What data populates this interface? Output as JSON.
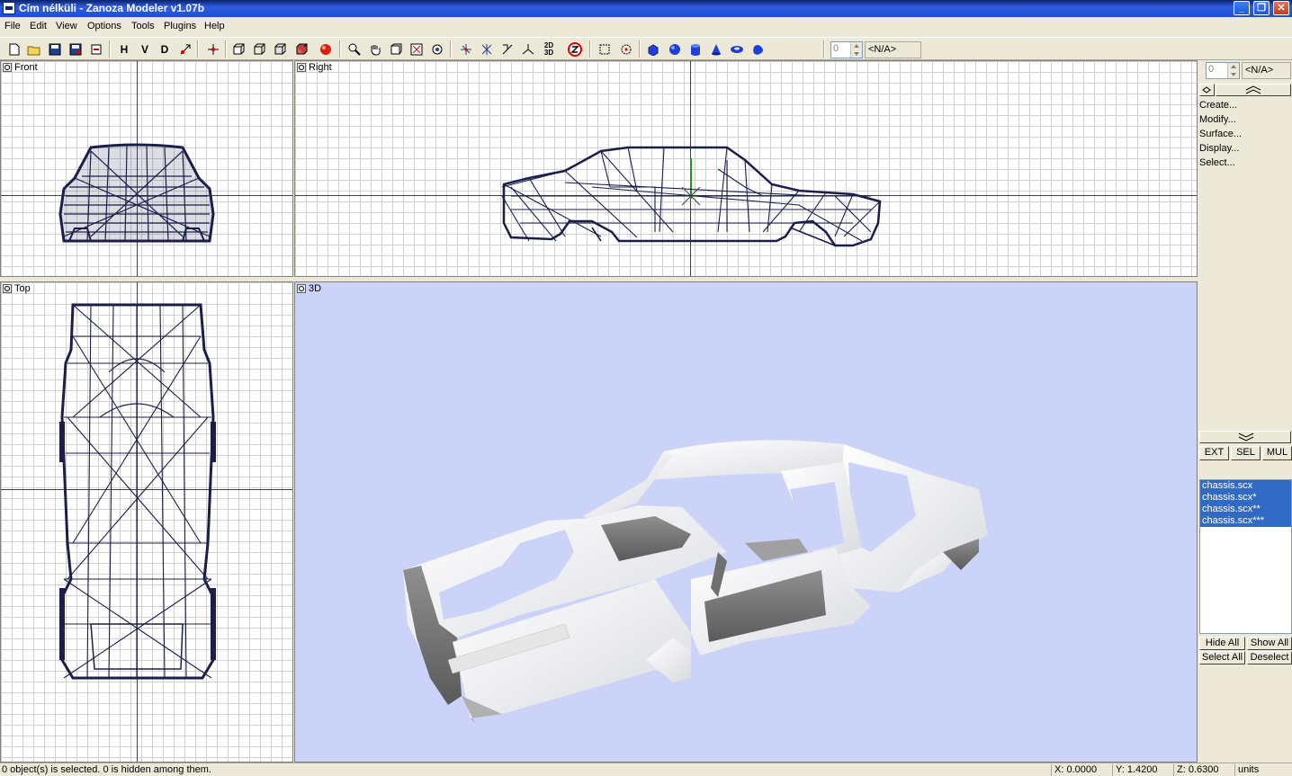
{
  "window": {
    "title": "Cím nélküli - Zanoza Modeler v1.07b",
    "minimize": "_",
    "restore": "❐",
    "close": "✕"
  },
  "menu": [
    "File",
    "Edit",
    "View",
    "Options",
    "Tools",
    "Plugins",
    "Help"
  ],
  "toolbar": {
    "view_buttons": [
      "H",
      "V",
      "D"
    ],
    "coord_labels": [
      "2D",
      "3D"
    ],
    "spinner_value": "0",
    "selection_field": "<N/A>"
  },
  "viewports": {
    "front": "Front",
    "right": "Right",
    "top": "Top",
    "perspective": "3D"
  },
  "panel": {
    "spinner_value": "0",
    "selection_field": "<N/A>",
    "commands": [
      "Create...",
      "Modify...",
      "Surface...",
      "Display...",
      "Select..."
    ],
    "mode_buttons": [
      "EXT",
      "SEL",
      "MUL"
    ],
    "objects": [
      "chassis.scx",
      "chassis.scx*",
      "chassis.scx**",
      "chassis.scx***"
    ],
    "hide_all": "Hide All",
    "show_all": "Show All",
    "select_all": "Select All",
    "deselect": "Deselect"
  },
  "status": {
    "message": "0 object(s) is selected. 0 is hidden among them.",
    "x": "X: 0.0000",
    "y": "Y: 1.4200",
    "z": "Z: 0.6300",
    "units": "units"
  },
  "colors": {
    "wireframe": "#1a1f4a",
    "viewport_3d": "#cbd3f8",
    "selection": "#316ac5",
    "title_bar": "#1d4fd6"
  }
}
